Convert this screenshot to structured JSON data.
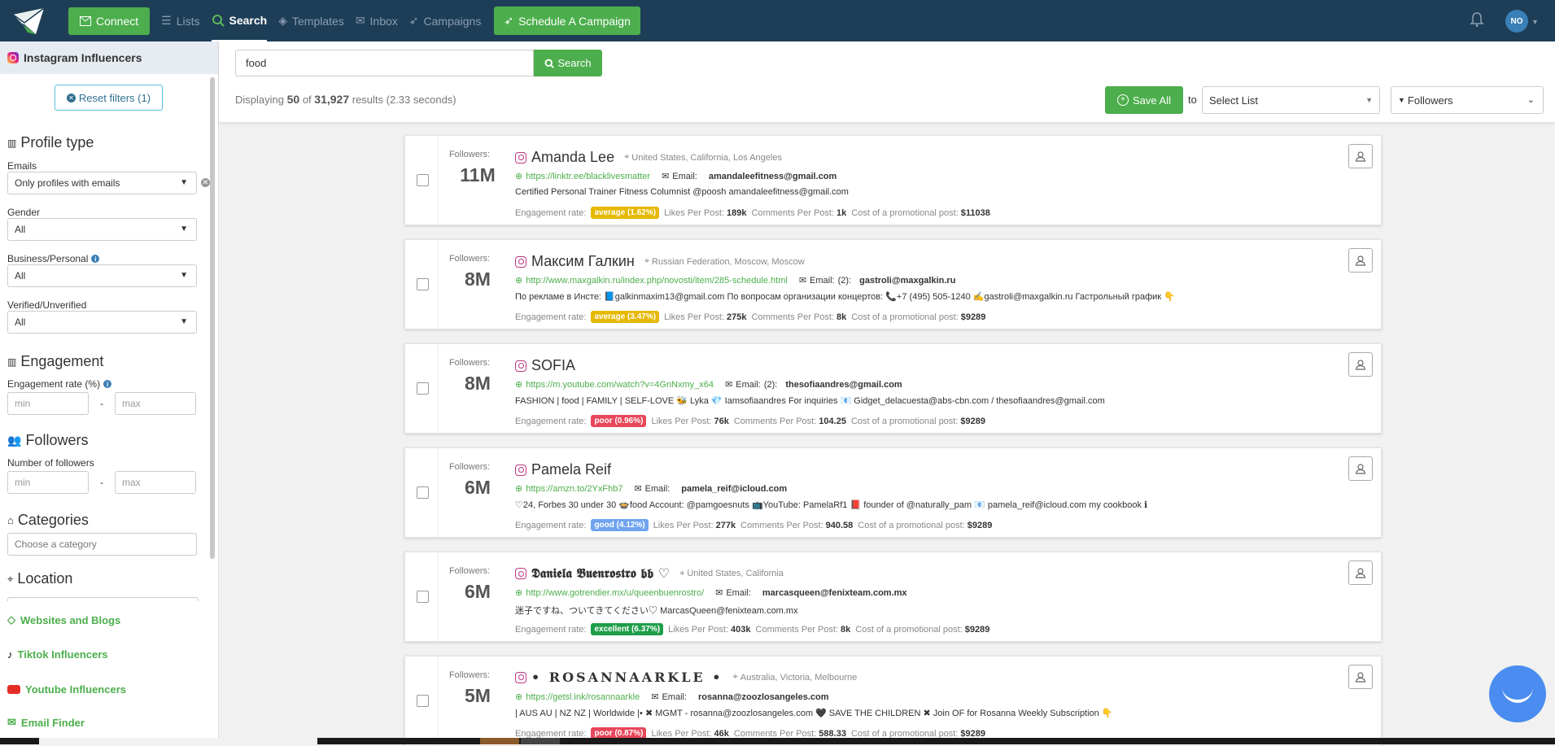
{
  "nav": {
    "connect_label": "Connect",
    "links": [
      {
        "label": "Lists",
        "icon": "list-icon"
      },
      {
        "label": "Search",
        "icon": "search-icon",
        "active": true
      },
      {
        "label": "Templates",
        "icon": "layers-icon"
      },
      {
        "label": "Inbox",
        "icon": "inbox-icon"
      },
      {
        "label": "Campaigns",
        "icon": "rocket-icon"
      }
    ],
    "schedule_label": "Schedule A Campaign",
    "avatar_initials": "NO"
  },
  "sidebar": {
    "header": "Instagram Influencers",
    "reset_label": "Reset filters (1)",
    "profile_type": {
      "title": "Profile type",
      "emails_label": "Emails",
      "emails_value": "Only profiles with emails",
      "gender_label": "Gender",
      "gender_value": "All",
      "business_label": "Business/Personal",
      "business_value": "All",
      "verified_label": "Verified/Unverified",
      "verified_value": "All"
    },
    "engagement": {
      "title": "Engagement",
      "rate_label": "Engagement rate (%)",
      "min_placeholder": "min",
      "max_placeholder": "max"
    },
    "followers": {
      "title": "Followers",
      "count_label": "Number of followers",
      "min_placeholder": "min",
      "max_placeholder": "max"
    },
    "categories": {
      "title": "Categories",
      "placeholder": "Choose a category"
    },
    "location": {
      "title": "Location"
    },
    "links": [
      {
        "label": "Websites and Blogs",
        "icon": "diamond-icon"
      },
      {
        "label": "Tiktok Influencers",
        "icon": "tiktok-icon"
      },
      {
        "label": "Youtube Influencers",
        "icon": "youtube-icon"
      },
      {
        "label": "Email Finder",
        "icon": "envelope-icon"
      }
    ]
  },
  "search": {
    "query": "food",
    "button_label": "Search",
    "display_prefix": "Displaying",
    "shown": "50",
    "of": "of",
    "total": "31,927",
    "suffix": "results (2.33 seconds)"
  },
  "toolbar": {
    "save_all_label": "Save All",
    "to_label": "to",
    "select_list_value": "Select List",
    "sort_value": "Followers"
  },
  "labels": {
    "followers": "Followers:",
    "email": "Email:",
    "engagement_rate": "Engagement rate:",
    "likes_per_post": "Likes Per Post:",
    "comments_per_post": "Comments Per Post:",
    "cost_promo": "Cost of a promotional post:"
  },
  "badge_colors": {
    "average": "#e6b800",
    "poor": "#e8465a",
    "good": "#6fa3ef",
    "excellent": "#1e9e4a"
  },
  "influencers": [
    {
      "followers": "11M",
      "name": "Amanda Lee",
      "location": "United States, California, Los Angeles",
      "url": "https://linktr.ee/blacklivesmatter",
      "email_count": "",
      "email": "amandaleefitness@gmail.com",
      "bio": "Certified Personal Trainer Fitness Columnist @poosh amandaleefitness@gmail.com",
      "engagement": "average (1.62%)",
      "engagement_level": "average",
      "likes": "189k",
      "comments": "1k",
      "cost": "$11038"
    },
    {
      "followers": "8M",
      "name": "Максим Галкин",
      "location": "Russian Federation, Moscow, Moscow",
      "url": "http://www.maxgalkin.ru/index.php/novosti/item/285-schedule.html",
      "email_count": "(2):",
      "email": "gastroli@maxgalkin.ru",
      "bio": "По рекламе в Инсте: 📘galkinmaxim13@gmail.com По вопросам организации концертов: 📞+7 (495) 505-1240 ✍gastroli@maxgalkin.ru Гастрольный график 👇",
      "engagement": "average (3.47%)",
      "engagement_level": "average",
      "likes": "275k",
      "comments": "8k",
      "cost": "$9289"
    },
    {
      "followers": "8M",
      "name": "SOFIA",
      "location": "",
      "url": "https://m.youtube.com/watch?v=4GnNxmy_x64",
      "email_count": "(2):",
      "email": "thesofiaandres@gmail.com",
      "bio": "FASHION | food | FAMILY | SELF-LOVE 🐝 Lyka 💎 Iamsofiaandres For inquiries 📧 Gidget_delacuesta@abs-cbn.com / thesofiaandres@gmail.com",
      "engagement": "poor (0.96%)",
      "engagement_level": "poor",
      "likes": "76k",
      "comments": "104.25",
      "cost": "$9289"
    },
    {
      "followers": "6M",
      "name": "Pamela Reif",
      "location": "",
      "url": "https://amzn.to/2YxFhb7",
      "email_count": "",
      "email": "pamela_reif@icloud.com",
      "bio": "♡24, Forbes 30 under 30 🍲food Account: @pamgoesnuts 📺YouTube: PamelaRf1 📕 founder of @naturally_pam 📧 pamela_reif@icloud.com my cookbook ℹ",
      "engagement": "good (4.12%)",
      "engagement_level": "good",
      "likes": "277k",
      "comments": "940.58",
      "cost": "$9289"
    },
    {
      "followers": "6M",
      "name": "𝕯𝖆𝖓𝖎𝖊𝖑𝖆 𝕭𝖚𝖊𝖓𝖗𝖔𝖘𝖙𝖗𝖔 𝖇𝖇 ♡",
      "location": "United States, California",
      "url": "http://www.gotrendier.mx/u/queenbuenrostro/",
      "email_count": "",
      "email": "marcasqueen@fenixteam.com.mx",
      "bio": "迷子ですね、ついてきてください♡ MarcasQueen@fenixteam.com.mx",
      "engagement": "excellent (6.37%)",
      "engagement_level": "excellent",
      "likes": "403k",
      "comments": "8k",
      "cost": "$9289"
    },
    {
      "followers": "5M",
      "name": "• ROSANNAARKLE •",
      "location": "Australia, Victoria, Melbourne",
      "url": "https://getsl.ink/rosannaarkle",
      "email_count": "",
      "email": "rosanna@zoozlosangeles.com",
      "bio": "| AUS AU | NZ NZ | Worldwide |• ✖ MGMT - rosanna@zoozlosangeles.com 🖤 SAVE THE CHILDREN ✖ Join OF for Rosanna Weekly Subscription 👇",
      "engagement": "poor (0.87%)",
      "engagement_level": "poor",
      "likes": "46k",
      "comments": "588.33",
      "cost": "$9289"
    }
  ]
}
